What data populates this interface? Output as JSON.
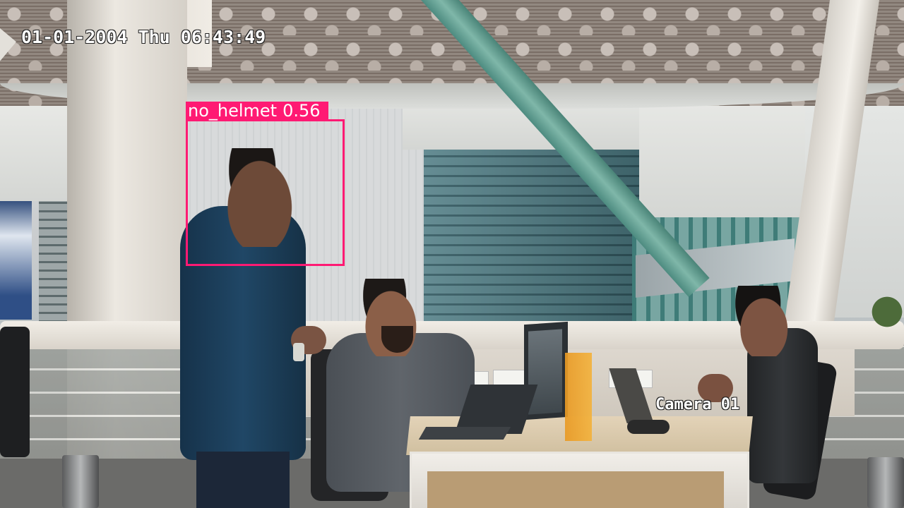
{
  "overlay": {
    "timestamp": "01-01-2004 Thu 06:43:49",
    "camera_label": "Camera 01"
  },
  "detection": {
    "class_label": "no_helmet",
    "confidence": "0.56",
    "box_color": "#ff1a73"
  },
  "scene": {
    "beam_color": "#6fa99b",
    "desk_panel_color": "#f1a82f"
  }
}
